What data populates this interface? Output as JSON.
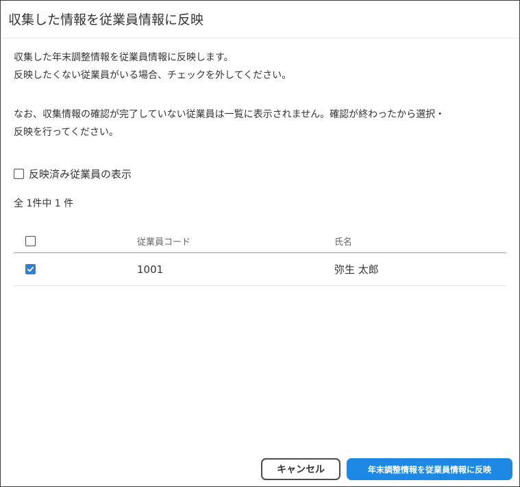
{
  "dialog": {
    "title": "収集した情報を従業員情報に反映",
    "paragraph1_line1": "収集した年末調整情報を従業員情報に反映します。",
    "paragraph1_line2": "反映したくない従業員がいる場合、チェックを外してください。",
    "paragraph2_line1": "なお、収集情報の確認が完了していない従業員は一覧に表示されません。確認が終わったから選択・",
    "paragraph2_line2": "反映を行ってください。"
  },
  "filter": {
    "show_reflected_label": "反映済み従業員の表示",
    "show_reflected_checked": false
  },
  "count_text": "全 1件中 1 件",
  "table": {
    "columns": {
      "code": "従業員コード",
      "name": "氏名"
    },
    "header_checked": false,
    "rows": [
      {
        "checked": true,
        "code": "1001",
        "name": "弥生 太郎"
      }
    ]
  },
  "footer": {
    "cancel_label": "キャンセル",
    "apply_label": "年末調整情報を従業員情報に反映"
  },
  "colors": {
    "accent": "#1e88e5",
    "checkbox_checked": "#2f7fd4"
  }
}
